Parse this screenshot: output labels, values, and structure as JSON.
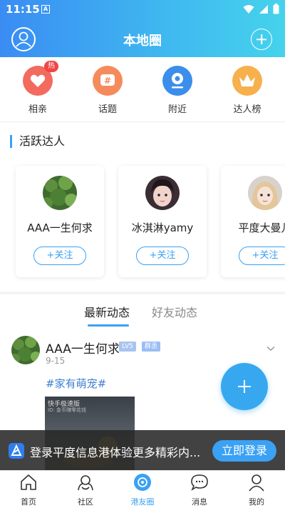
{
  "status_bar": {
    "time": "11:15",
    "a_icon": "A"
  },
  "header": {
    "title": "本地圈"
  },
  "categories": [
    {
      "label": "相亲",
      "icon": "heart-icon",
      "color": "#f26b5e",
      "badge": "热"
    },
    {
      "label": "话题",
      "icon": "hash-icon",
      "color": "#f58b5d"
    },
    {
      "label": "附近",
      "icon": "location-icon",
      "color": "#3b8eea"
    },
    {
      "label": "达人榜",
      "icon": "crown-icon",
      "color": "#f6b04c"
    }
  ],
  "experts": {
    "title": "活跃达人",
    "follow_label": "+关注",
    "items": [
      {
        "name": "AAA一生何求"
      },
      {
        "name": "冰淇淋yamy"
      },
      {
        "name": "平度大曼儿"
      }
    ]
  },
  "tabs": [
    {
      "label": "最新动态"
    },
    {
      "label": "好友动态"
    }
  ],
  "post": {
    "author": "AAA一生何求",
    "level": "LV5",
    "role": "群丞",
    "date": "9-15",
    "tag": "#家有萌宠#",
    "watermark": "快手极速版",
    "watermark_sub": "ID: 金币赚零花钱"
  },
  "login_bar": {
    "text": "登录平度信息港体验更多精彩内...",
    "button": "立即登录"
  },
  "nav": [
    {
      "label": "首页",
      "icon": "home-icon"
    },
    {
      "label": "社区",
      "icon": "community-icon"
    },
    {
      "label": "港友圈",
      "icon": "circle-icon",
      "active": true
    },
    {
      "label": "消息",
      "icon": "message-icon"
    },
    {
      "label": "我的",
      "icon": "profile-icon"
    }
  ]
}
